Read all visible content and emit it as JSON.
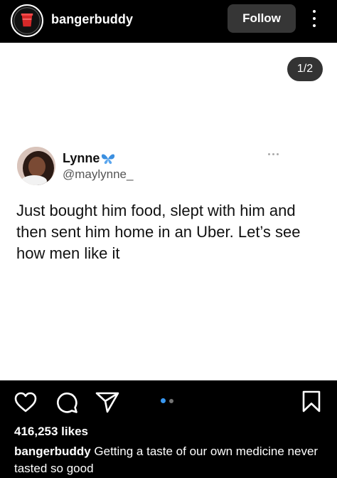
{
  "header": {
    "username": "bangerbuddy",
    "follow_label": "Follow",
    "more_icon": "more-vertical-icon"
  },
  "post": {
    "counter": "1/2",
    "tweet": {
      "name": "Lynne",
      "handle": "@maylynne_",
      "text": "Just bought him food, slept with him and then sent him home in an Uber. Let’s see how men like it",
      "badge_icon": "butterfly-icon"
    }
  },
  "actions": {
    "like_icon": "heart-icon",
    "comment_icon": "comment-icon",
    "share_icon": "send-icon",
    "save_icon": "bookmark-icon",
    "carousel": {
      "current": 1,
      "total": 2
    },
    "likes": "416,253 likes"
  },
  "caption": {
    "username": "bangerbuddy",
    "text": " Getting a taste of our own medicine never tasted so good"
  },
  "colors": {
    "follow_bg": "#363636",
    "active_dot": "#3897f0",
    "inactive_dot": "#737373",
    "butterfly": "#3b8fe0"
  }
}
